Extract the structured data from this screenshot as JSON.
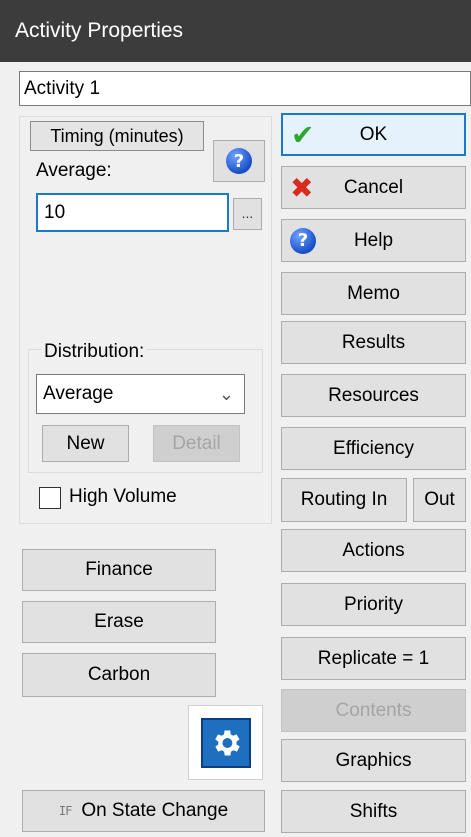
{
  "window": {
    "title": "Activity Properties"
  },
  "activity_name": "Activity 1",
  "timing": {
    "group_label": "Timing (minutes)",
    "average_label": "Average:",
    "average_value": "10",
    "ellipsis_label": "...",
    "distribution_label": "Distribution:",
    "distribution_selected": "Average",
    "new_label": "New",
    "detail_label": "Detail",
    "high_volume_label": "High Volume",
    "high_volume_checked": false
  },
  "left_buttons": {
    "finance": "Finance",
    "erase": "Erase",
    "carbon": "Carbon",
    "on_state_change": "On State Change",
    "on_state_change_icon": "IF"
  },
  "right_buttons": {
    "ok": "OK",
    "cancel": "Cancel",
    "help": "Help",
    "memo": "Memo",
    "results": "Results",
    "resources": "Resources",
    "efficiency": "Efficiency",
    "routing_in": "Routing In",
    "out": "Out",
    "actions": "Actions",
    "priority": "Priority",
    "replicate": "Replicate = 1",
    "contents": "Contents",
    "graphics": "Graphics",
    "shifts": "Shifts"
  },
  "icons": {
    "ok": "checkmark-icon",
    "cancel": "x-icon",
    "help": "question-icon",
    "settings": "gear-icon"
  },
  "colors": {
    "titlebar": "#3c3c3c",
    "focus_border": "#1979ca",
    "check_green": "#2ea72e",
    "cancel_red": "#d72b1e",
    "help_blue": "#1a4fc8"
  }
}
